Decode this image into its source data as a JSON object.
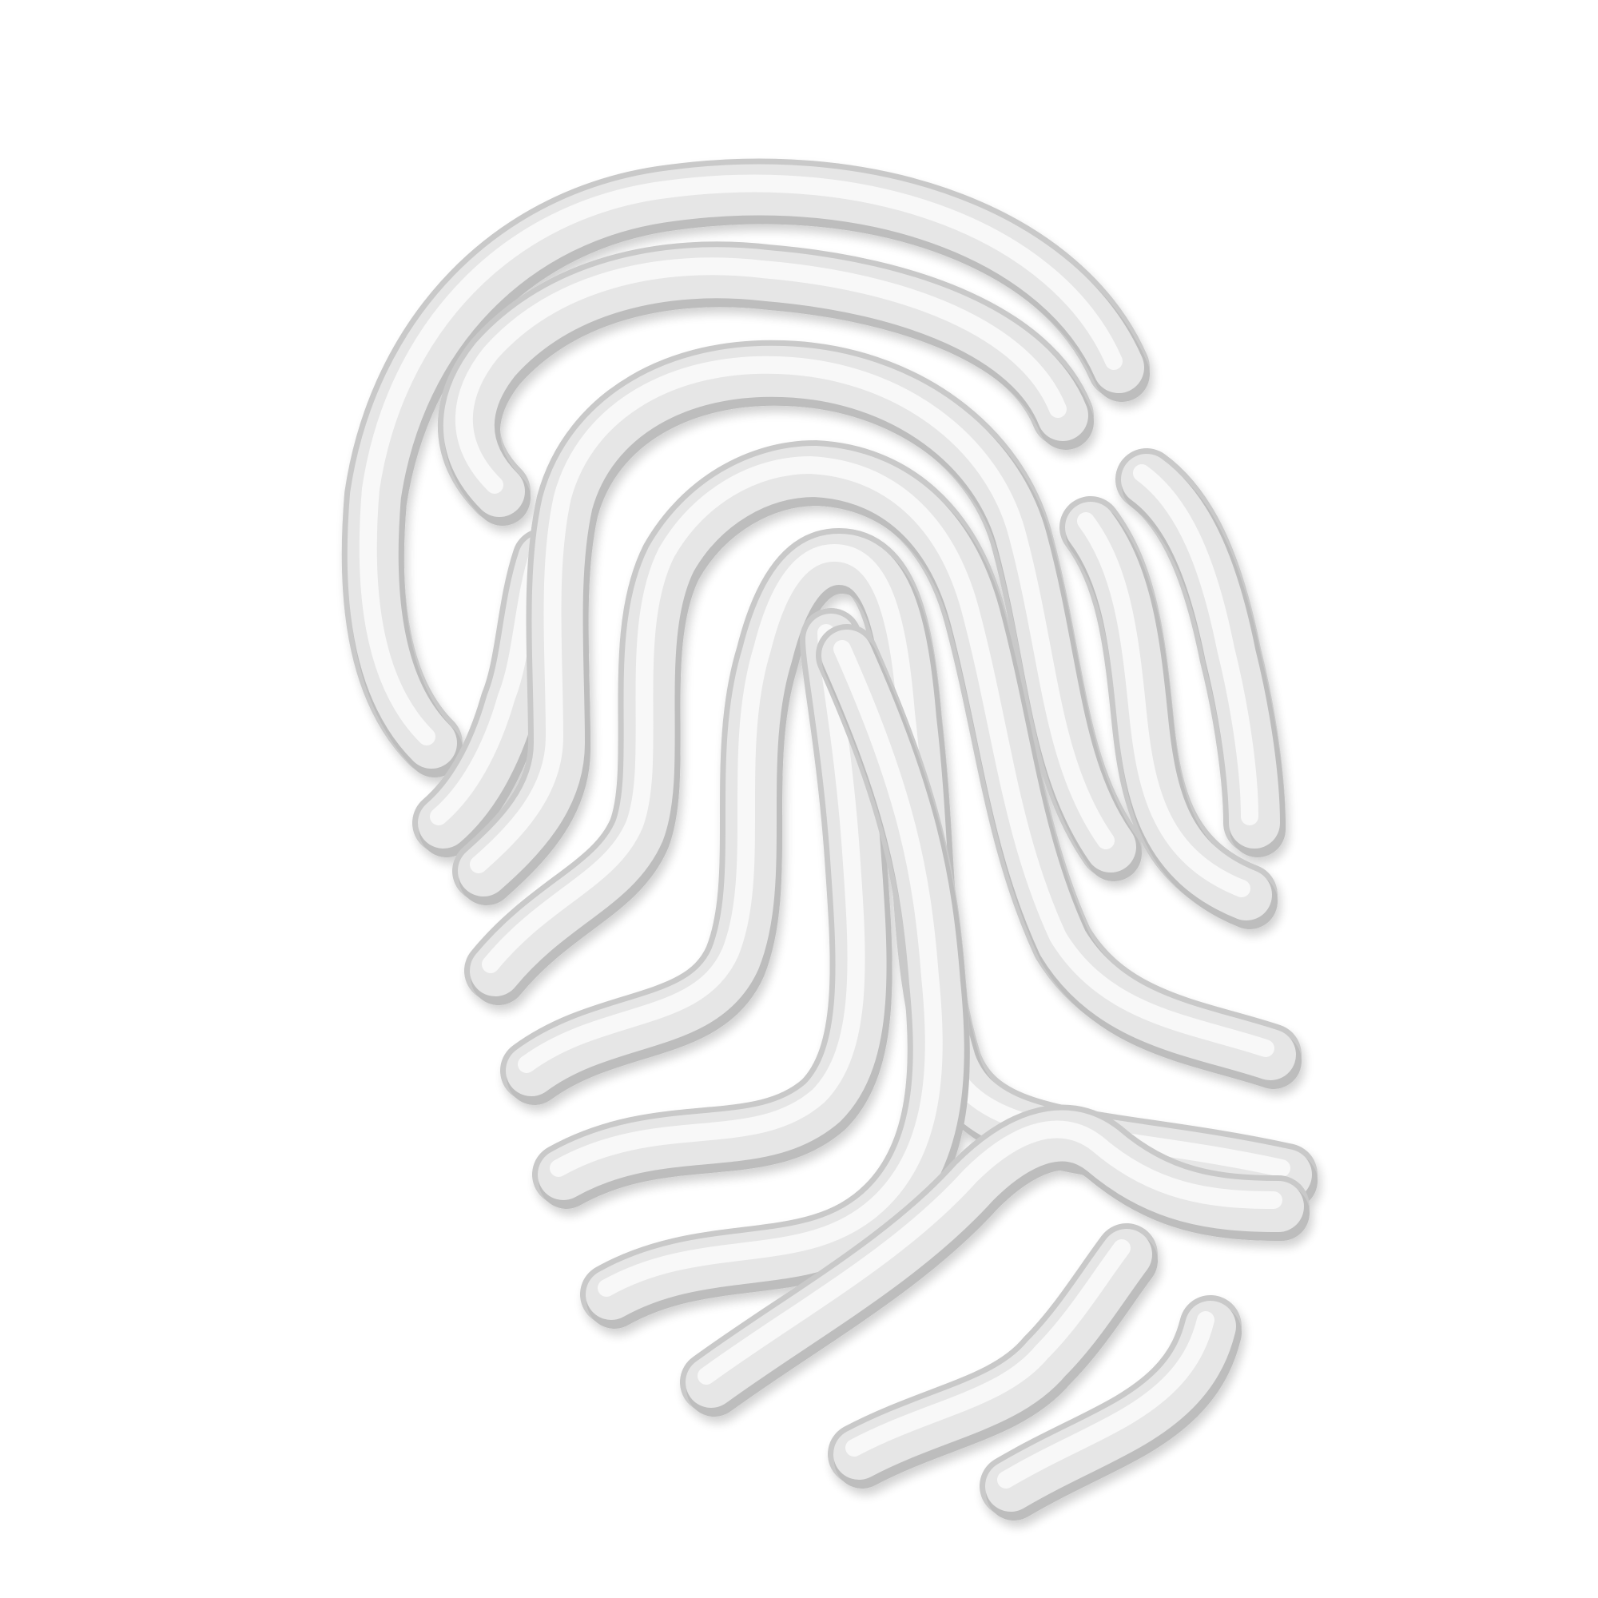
{
  "image": {
    "subject_icon": "fingerprint-icon",
    "style": "3d-render",
    "colors": {
      "background": "#ffffff",
      "ridge_base": "#e6e6e6",
      "ridge_shadow": "#bdbdbd",
      "ridge_highlight": "#fafafa",
      "ridge_edge": "#c9c9c9"
    }
  }
}
